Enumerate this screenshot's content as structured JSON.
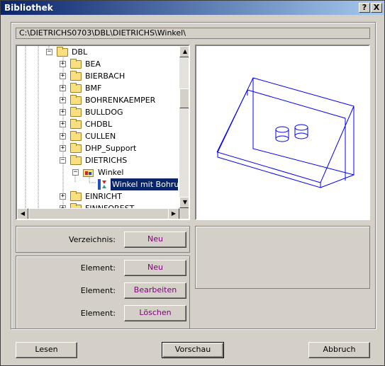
{
  "window": {
    "title": "Bibliothek",
    "help_label": "?",
    "close_label": "X"
  },
  "path": "C:\\DIETRICHS0703\\DBL\\DIETRICHS\\Winkel\\",
  "tree": {
    "expand_plus": "+",
    "expand_minus": "−",
    "root": "DBL",
    "items": [
      "BEA",
      "BIERBACH",
      "BMF",
      "BOHRENKAEMPER",
      "BULLDOG",
      "CHDBL",
      "CULLEN",
      "DHP_Support",
      "DIETRICHS"
    ],
    "subfolder": "Winkel",
    "element": "Winkel mit Bohrung",
    "after_items": [
      "EINRICHT",
      "FINNFOREST"
    ]
  },
  "actions": {
    "verzeichnis_label": "Verzeichnis:",
    "verzeichnis_new": "Neu",
    "element_label": "Element:",
    "element_new": "Neu",
    "element_edit": "Bearbeiten",
    "element_delete": "Löschen"
  },
  "footer": {
    "load": "Lesen",
    "preview": "Vorschau",
    "cancel": "Abbruch"
  },
  "colors": {
    "title_start": "#0a246a",
    "title_end": "#a6caf0",
    "wireframe": "#0000ff",
    "accent_text": "#800080"
  }
}
